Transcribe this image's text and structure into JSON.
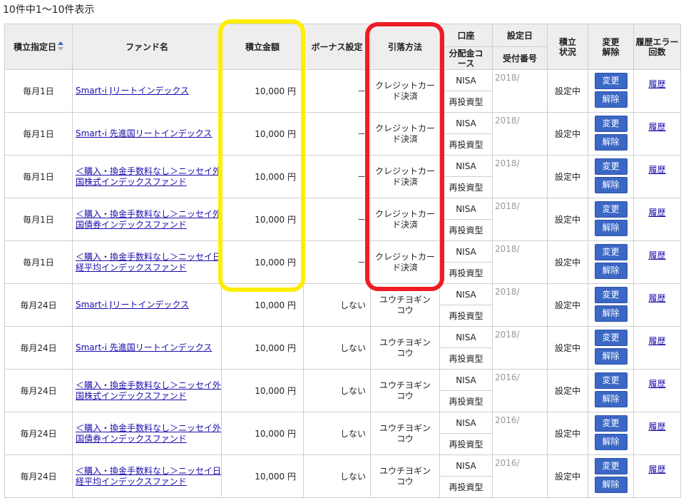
{
  "summary": "10件中1～10件表示",
  "headers": {
    "date": "積立指定日",
    "fund": "ファンド名",
    "amount": "積立金額",
    "bonus": "ボーナス設定",
    "method": "引落方法",
    "account": "口座",
    "distribution": "分配金コース",
    "set_date": "設定日",
    "receipt": "受付番号",
    "status": "積立状況",
    "change": "変更解除",
    "history": "履歴エラー回数"
  },
  "buttons": {
    "change": "変更",
    "cancel": "解除"
  },
  "history_link": "履歴",
  "rows": [
    {
      "day": "毎月1日",
      "fund": "Smart-i Jリートインデックス",
      "amount": "10,000 円",
      "bonus": "－",
      "method": "クレジットカード決済",
      "account": "NISA",
      "course": "再投資型",
      "set_date": "2018/",
      "status": "設定中"
    },
    {
      "day": "毎月1日",
      "fund": "Smart-i 先進国リートインデックス",
      "amount": "10,000 円",
      "bonus": "－",
      "method": "クレジットカード決済",
      "account": "NISA",
      "course": "再投資型",
      "set_date": "2018/",
      "status": "設定中"
    },
    {
      "day": "毎月1日",
      "fund": "＜購入・換金手数料なし＞ニッセイ外国株式インデックスファンド",
      "amount": "10,000 円",
      "bonus": "－",
      "method": "クレジットカード決済",
      "account": "NISA",
      "course": "再投資型",
      "set_date": "2018/",
      "status": "設定中"
    },
    {
      "day": "毎月1日",
      "fund": "＜購入・換金手数料なし＞ニッセイ外国債券インデックスファンド",
      "amount": "10,000 円",
      "bonus": "－",
      "method": "クレジットカード決済",
      "account": "NISA",
      "course": "再投資型",
      "set_date": "2018/",
      "status": "設定中"
    },
    {
      "day": "毎月1日",
      "fund": "＜購入・換金手数料なし＞ニッセイ日経平均インデックスファンド",
      "amount": "10,000 円",
      "bonus": "－",
      "method": "クレジットカード決済",
      "account": "NISA",
      "course": "再投資型",
      "set_date": "2018/",
      "status": "設定中"
    },
    {
      "day": "毎月24日",
      "fund": "Smart-i Jリートインデックス",
      "amount": "10,000 円",
      "bonus": "しない",
      "method": "ユウチヨギンコウ",
      "account": "NISA",
      "course": "再投資型",
      "set_date": "2018/",
      "status": "設定中"
    },
    {
      "day": "毎月24日",
      "fund": "Smart-i 先進国リートインデックス",
      "amount": "10,000 円",
      "bonus": "しない",
      "method": "ユウチヨギンコウ",
      "account": "NISA",
      "course": "再投資型",
      "set_date": "2018/",
      "status": "設定中"
    },
    {
      "day": "毎月24日",
      "fund": "＜購入・換金手数料なし＞ニッセイ外国株式インデックスファンド",
      "amount": "10,000 円",
      "bonus": "しない",
      "method": "ユウチヨギンコウ",
      "account": "NISA",
      "course": "再投資型",
      "set_date": "2016/",
      "status": "設定中"
    },
    {
      "day": "毎月24日",
      "fund": "＜購入・換金手数料なし＞ニッセイ外国債券インデックスファンド",
      "amount": "10,000 円",
      "bonus": "しない",
      "method": "ユウチヨギンコウ",
      "account": "NISA",
      "course": "再投資型",
      "set_date": "2016/",
      "status": "設定中"
    },
    {
      "day": "毎月24日",
      "fund": "＜購入・換金手数料なし＞ニッセイ日経平均インデックスファンド",
      "amount": "10,000 円",
      "bonus": "しない",
      "method": "ユウチヨギンコウ",
      "account": "NISA",
      "course": "再投資型",
      "set_date": "2016/",
      "status": "設定中"
    }
  ]
}
